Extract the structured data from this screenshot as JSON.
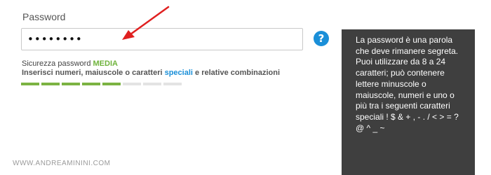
{
  "form": {
    "password_label": "Password",
    "password_value": "••••••••",
    "help_icon_glyph": "?",
    "strength_prefix": "Sicurezza password",
    "strength_level": "MEDIA",
    "hint_part1": "Inserisci numeri, maiuscole o caratteri",
    "hint_link": "speciali",
    "hint_part2": "e relative combinazioni",
    "strength_meter": {
      "segments_total": 8,
      "segments_filled": 5
    }
  },
  "tooltip": {
    "text": "La password è una parola che deve rimanere segreta. Puoi utilizzare da 8 a 24 caratteri; può contenere lettere minuscole o maiuscole, numeri e uno o più tra i seguenti caratteri speciali ! $ & + , - . / < > = ? @ ^ _ ~"
  },
  "watermark": "WWW.ANDREAMININI.COM",
  "colors": {
    "arrow": "#e02020",
    "help_icon": "#1a8fd8",
    "meter_filled": "#7cb342",
    "meter_empty": "#e3e3e3",
    "strength_level": "#6fb33c",
    "tooltip_bg": "#3f3f3f"
  },
  "icons": {
    "arrow": "red-arrow-icon",
    "help": "question-mark-icon"
  }
}
